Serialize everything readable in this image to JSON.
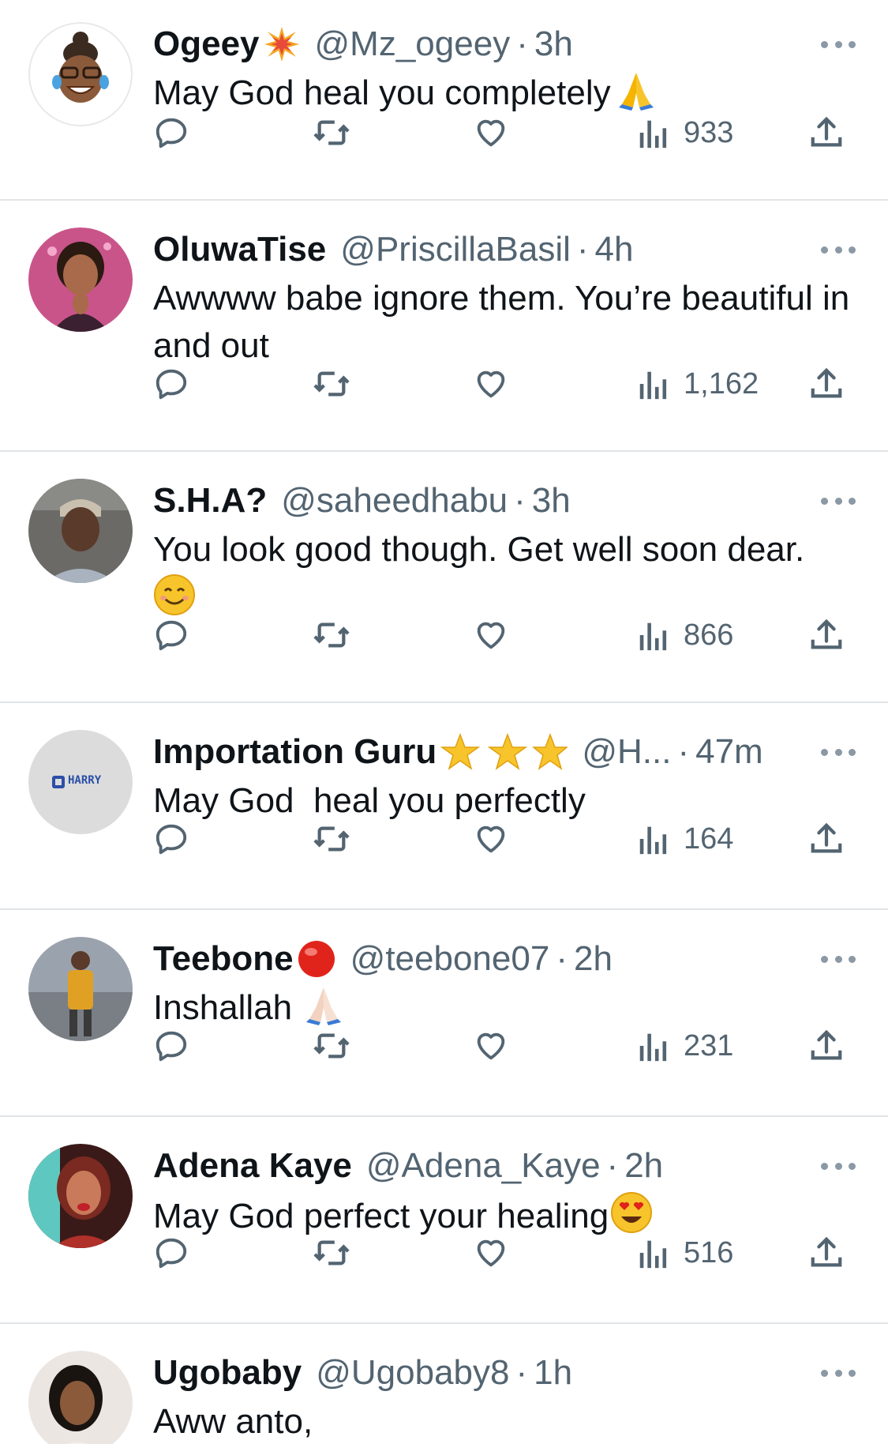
{
  "tweets": [
    {
      "name": "Ogeey",
      "name_emoji": "collision",
      "handle": "@Mz_ogeey",
      "separator": "·",
      "time": "3h",
      "text": "May God heal you completely",
      "text_emoji": "folded-hands",
      "views": "933",
      "avatar_colors": {
        "bg": "#ffffff",
        "face": "#8a5a3b",
        "hair": "#3a2a20"
      }
    },
    {
      "name": "OluwaTise",
      "handle": "@PriscillaBasil",
      "separator": "·",
      "time": "4h",
      "text": "Awwww babe ignore them. You’re beautiful in and out",
      "views": "1,162",
      "avatar_colors": {
        "bg": "#c9548a",
        "face": "#a86a4a",
        "hair": "#2b1a12"
      }
    },
    {
      "name": "S.H.A?",
      "handle": "@saheedhabu",
      "separator": "·",
      "time": "3h",
      "text": "You look good though. Get well soon dear.",
      "text_emoji": "smiling-face",
      "views": "866",
      "avatar_colors": {
        "bg": "#6b6a66",
        "face": "#5a3a2a",
        "hair": "#c9c0b0"
      }
    },
    {
      "name": "Importation Guru",
      "name_emoji": "glowing-stars",
      "handle": "@H...",
      "separator": "·",
      "time": "47m",
      "text": "May God  heal you perfectly",
      "views": "164",
      "avatar_colors": {
        "bg": "#dcdcdc",
        "logo": "#2b4fa8"
      },
      "avatar_logo_text": "HARRY"
    },
    {
      "name": "Teebone",
      "name_emoji": "red-circle",
      "handle": "@teebone07",
      "separator": "·",
      "time": "2h",
      "text": "Inshallah",
      "text_emoji": "folded-hands-light",
      "views": "231",
      "avatar_colors": {
        "bg": "#9aa3ad",
        "shirt": "#e0a024",
        "face": "#5a3a2a"
      }
    },
    {
      "name": "Adena Kaye",
      "handle": "@Adena_Kaye",
      "separator": "·",
      "time": "2h",
      "text": "May God perfect your healing",
      "text_emoji": "heart-eyes",
      "views": "516",
      "avatar_colors": {
        "bg": "#3a1a18",
        "face": "#c97a5a",
        "hair": "#7a2a20"
      }
    },
    {
      "name": "Ugobaby",
      "handle": "@Ugobaby8",
      "separator": "·",
      "time": "1h",
      "text": "Aww anto,",
      "avatar_colors": {
        "bg": "#ece6e2",
        "face": "#8a5a3a",
        "hair": "#1a1410"
      }
    }
  ],
  "icons": {
    "reply": "reply-icon",
    "retweet": "retweet-icon",
    "like": "heart-icon",
    "views": "views-icon",
    "share": "share-icon",
    "more": "more-icon"
  },
  "colors": {
    "icon_gray": "#536471",
    "divider": "#e1e4e7",
    "text_primary": "#0f1419",
    "text_secondary": "#536471"
  }
}
